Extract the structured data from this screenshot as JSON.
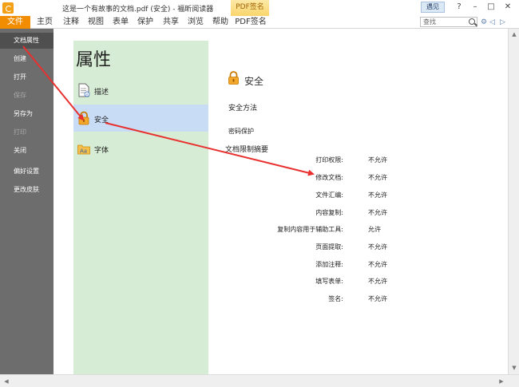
{
  "window": {
    "title": "这是一个有故事的文档.pdf (安全) - 福昕阅读器",
    "context_tab": "PDF签名",
    "mode_button": "遇见",
    "controls": [
      "?",
      "–",
      "□",
      "✕"
    ]
  },
  "menubar": {
    "items": [
      "文件",
      "主页",
      "注释",
      "视图",
      "表单",
      "保护",
      "共享",
      "浏览",
      "帮助",
      "PDF签名"
    ],
    "search_placeholder": "查找"
  },
  "backstage": {
    "items": [
      {
        "label": "文档属性",
        "state": "active"
      },
      {
        "label": "创建",
        "state": "normal"
      },
      {
        "label": "打开",
        "state": "normal"
      },
      {
        "label": "保存",
        "state": "disabled"
      },
      {
        "label": "另存为",
        "state": "normal"
      },
      {
        "label": "打印",
        "state": "disabled"
      },
      {
        "label": "关闭",
        "state": "normal"
      },
      {
        "label": "偏好设置",
        "state": "normal"
      },
      {
        "label": "更改皮肤",
        "state": "normal"
      }
    ]
  },
  "properties": {
    "title": "属性",
    "categories": [
      {
        "label": "描述",
        "icon": "document-info-icon"
      },
      {
        "label": "安全",
        "icon": "lock-icon",
        "selected": true
      },
      {
        "label": "字体",
        "icon": "font-folder-icon"
      }
    ]
  },
  "security": {
    "heading": "安全",
    "method_label": "安全方法",
    "method_value": "密码保护",
    "restrictions_title": "文档限制摘要",
    "permissions": [
      {
        "name": "打印权限:",
        "value": "不允许"
      },
      {
        "name": "修改文档:",
        "value": "不允许"
      },
      {
        "name": "文件汇编:",
        "value": "不允许"
      },
      {
        "name": "内容复制:",
        "value": "不允许"
      },
      {
        "name": "复制内容用于辅助工具:",
        "value": "允许"
      },
      {
        "name": "页面提取:",
        "value": "不允许"
      },
      {
        "name": "添加注释:",
        "value": "不允许"
      },
      {
        "name": "填写表单:",
        "value": "不允许"
      },
      {
        "name": "签名:",
        "value": "不允许"
      }
    ]
  },
  "annotation_color": "#e8312f"
}
